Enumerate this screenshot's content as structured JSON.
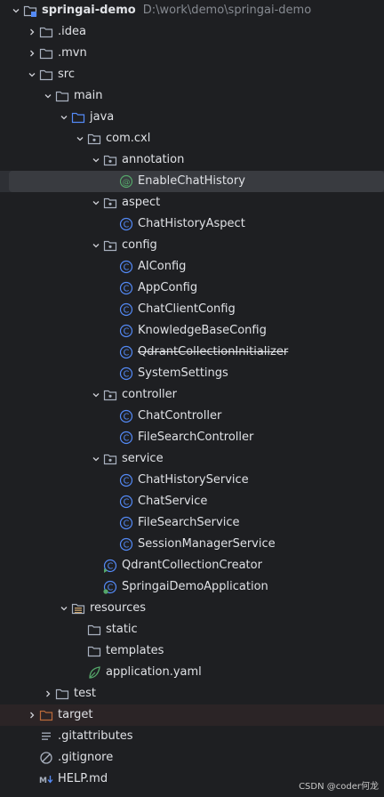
{
  "colors": {
    "background": "#1e1f22",
    "selection": "#393b40",
    "folder": "#a9b1bf",
    "source_folder": "#548af7",
    "resources_folder": "#c9a26d",
    "excluded_folder": "#b96a3a",
    "class_icon": "#548af7",
    "annotation_icon": "#55a76a"
  },
  "project": {
    "name": "springai-demo",
    "path": "D:\\work\\demo\\springai-demo"
  },
  "tree": {
    "idea": ".idea",
    "mvn": ".mvn",
    "src": "src",
    "main": "main",
    "java": "java",
    "package": "com.cxl",
    "annotation": "annotation",
    "enable_chat_history": "EnableChatHistory",
    "aspect": "aspect",
    "chat_history_aspect": "ChatHistoryAspect",
    "config": "config",
    "ai_config": "AIConfig",
    "app_config": "AppConfig",
    "chat_client_config": "ChatClientConfig",
    "knowledge_base_config": "KnowledgeBaseConfig",
    "qdrant_collection_initializer": "QdrantCollectionInitializer",
    "system_settings": "SystemSettings",
    "controller": "controller",
    "chat_controller": "ChatController",
    "file_search_controller": "FileSearchController",
    "service": "service",
    "chat_history_service": "ChatHistoryService",
    "chat_service": "ChatService",
    "file_search_service": "FileSearchService",
    "session_manager_service": "SessionManagerService",
    "qdrant_collection_creator": "QdrantCollectionCreator",
    "springai_demo_application": "SpringaiDemoApplication",
    "resources": "resources",
    "static": "static",
    "templates": "templates",
    "application_yaml": "application.yaml",
    "test": "test",
    "target": "target",
    "gitattributes": ".gitattributes",
    "gitignore": ".gitignore",
    "help_md": "HELP.md"
  },
  "watermark": "CSDN @coder何龙"
}
